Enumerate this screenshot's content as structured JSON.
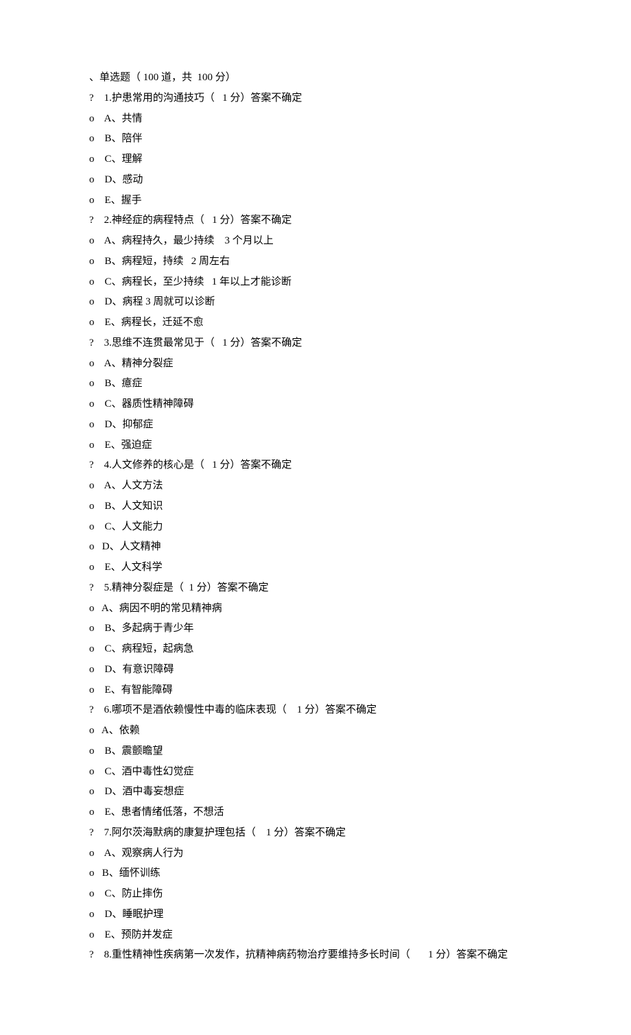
{
  "header": "、单选题（ 100 道，共  100 分）",
  "q_marker": "?",
  "opt_marker": "o",
  "questions": [
    {
      "stem": "1.护患常用的沟通技巧（   1 分）答案不确定",
      "options": [
        "A、共情",
        "B、陪伴",
        "C、理解",
        "D、感动",
        "E、握手"
      ],
      "indent": [
        1,
        1,
        1,
        1,
        1
      ]
    },
    {
      "stem": "2.神经症的病程特点（   1 分）答案不确定",
      "options": [
        "A、病程持久，最少持续    3 个月以上",
        "B、病程短，持续   2 周左右",
        "C、病程长，至少持续   1 年以上才能诊断",
        "D、病程 3 周就可以诊断",
        "E、病程长，迁延不愈"
      ],
      "indent": [
        1,
        1,
        1,
        1,
        1
      ]
    },
    {
      "stem": "3.思维不连贯最常见于（   1 分）答案不确定",
      "options": [
        "A、精神分裂症",
        "B、癔症",
        "C、器质性精神障碍",
        "D、抑郁症",
        "E、强迫症"
      ],
      "indent": [
        1,
        1,
        1,
        1,
        1
      ]
    },
    {
      "stem": "4.人文修养的核心是（   1 分）答案不确定",
      "options": [
        "A、人文方法",
        "B、人文知识",
        "C、人文能力",
        "D、人文精神",
        "E、人文科学"
      ],
      "indent": [
        1,
        1,
        1,
        0,
        1
      ]
    },
    {
      "stem": "5.精神分裂症是（  1 分）答案不确定",
      "options": [
        "A、病因不明的常见精神病",
        "B、多起病于青少年",
        "C、病程短，起病急",
        "D、有意识障碍",
        "E、有智能障碍"
      ],
      "indent": [
        0,
        1,
        1,
        1,
        1
      ]
    },
    {
      "stem": "6.哪项不是酒依赖慢性中毒的临床表现（    1 分）答案不确定",
      "options": [
        "A、依赖",
        "B、震颤瞻望",
        "C、酒中毒性幻觉症",
        "D、酒中毒妄想症",
        "E、患者情绪低落，不想活"
      ],
      "indent": [
        0,
        1,
        1,
        1,
        1
      ]
    },
    {
      "stem": "7.阿尔茨海默病的康复护理包括（    1 分）答案不确定",
      "options": [
        "A、观察病人行为",
        "B、缅怀训练",
        "C、防止摔伤",
        "D、睡眠护理",
        "E、预防并发症"
      ],
      "indent": [
        1,
        0,
        1,
        1,
        1
      ]
    },
    {
      "stem": "8.重性精神性疾病第一次发作，抗精神病药物治疗要维持多长时间（       1 分）答案不确定",
      "options": [],
      "indent": []
    }
  ]
}
